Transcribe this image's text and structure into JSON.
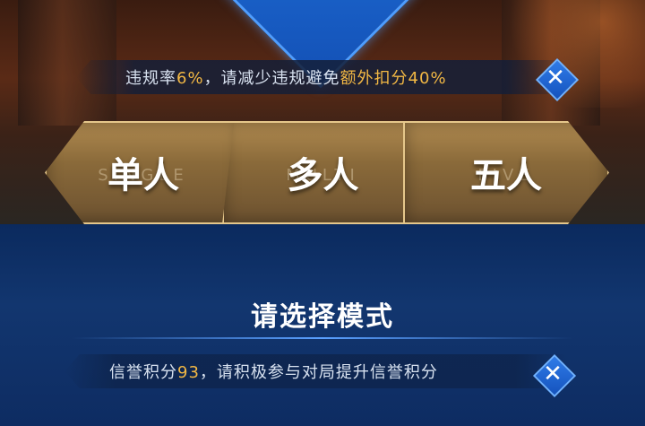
{
  "top_notice": {
    "prefix": "违规率",
    "rate": "6%",
    "middle": "，请减少违规避免",
    "highlight": "额外扣分40%",
    "close_icon": "close-icon"
  },
  "modes": [
    {
      "label": "单人",
      "subtitle": "SINGLE"
    },
    {
      "label": "多人",
      "subtitle": "MULTI"
    },
    {
      "label": "五人",
      "subtitle": "FIVE"
    }
  ],
  "panel": {
    "title": "请选择模式"
  },
  "bottom_notice": {
    "prefix": "信誉积分",
    "score": "93",
    "suffix": "，请积极参与对局提升信誉积分",
    "close_icon": "close-icon"
  },
  "colors": {
    "highlight": "#f2b844",
    "accent_blue": "#2f7be8",
    "gold_border": "#e5c78b"
  }
}
